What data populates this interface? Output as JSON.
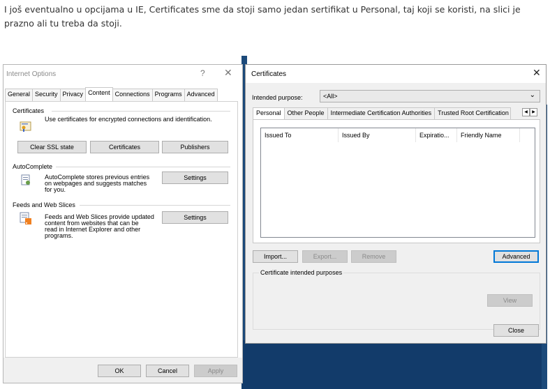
{
  "post": {
    "text": "I još eventualno u opcijama u IE, Certificates sme da stoji samo jedan sertifikat u Personal, taj koji se koristi, na slici je prazno ali tu treba da stoji."
  },
  "internet_options": {
    "title": "Internet Options",
    "help": "?",
    "close": "✕",
    "tabs": [
      "General",
      "Security",
      "Privacy",
      "Content",
      "Connections",
      "Programs",
      "Advanced"
    ],
    "active_tab": "Content",
    "certificates": {
      "heading": "Certificates",
      "description": "Use certificates for encrypted connections and identification.",
      "clear_ssl": "Clear SSL state",
      "certificates_btn": "Certificates",
      "publishers": "Publishers"
    },
    "autocomplete": {
      "heading": "AutoComplete",
      "line1": "AutoComplete stores previous entries",
      "line2": "on webpages and suggests matches",
      "line3": "for you.",
      "settings": "Settings"
    },
    "feeds": {
      "heading": "Feeds and Web Slices",
      "line1": "Feeds and Web Slices provide updated",
      "line2": "content from websites that can be",
      "line3": "read in Internet Explorer and other",
      "line4": "programs.",
      "settings": "Settings"
    },
    "footer": {
      "ok": "OK",
      "cancel": "Cancel",
      "apply": "Apply"
    }
  },
  "certificates_dialog": {
    "title": "Certificates",
    "close": "✕",
    "intended_purpose_label": "Intended purpose:",
    "intended_purpose_value": "<All>",
    "tabs": [
      "Personal",
      "Other People",
      "Intermediate Certification Authorities",
      "Trusted Root Certification"
    ],
    "active_tab": "Personal",
    "columns": [
      "Issued To",
      "Issued By",
      "Expiratio...",
      "Friendly Name"
    ],
    "buttons": {
      "import": "Import...",
      "export": "Export...",
      "remove": "Remove",
      "advanced": "Advanced",
      "view": "View",
      "close": "Close"
    },
    "intended_purposes_label": "Certificate intended purposes"
  }
}
